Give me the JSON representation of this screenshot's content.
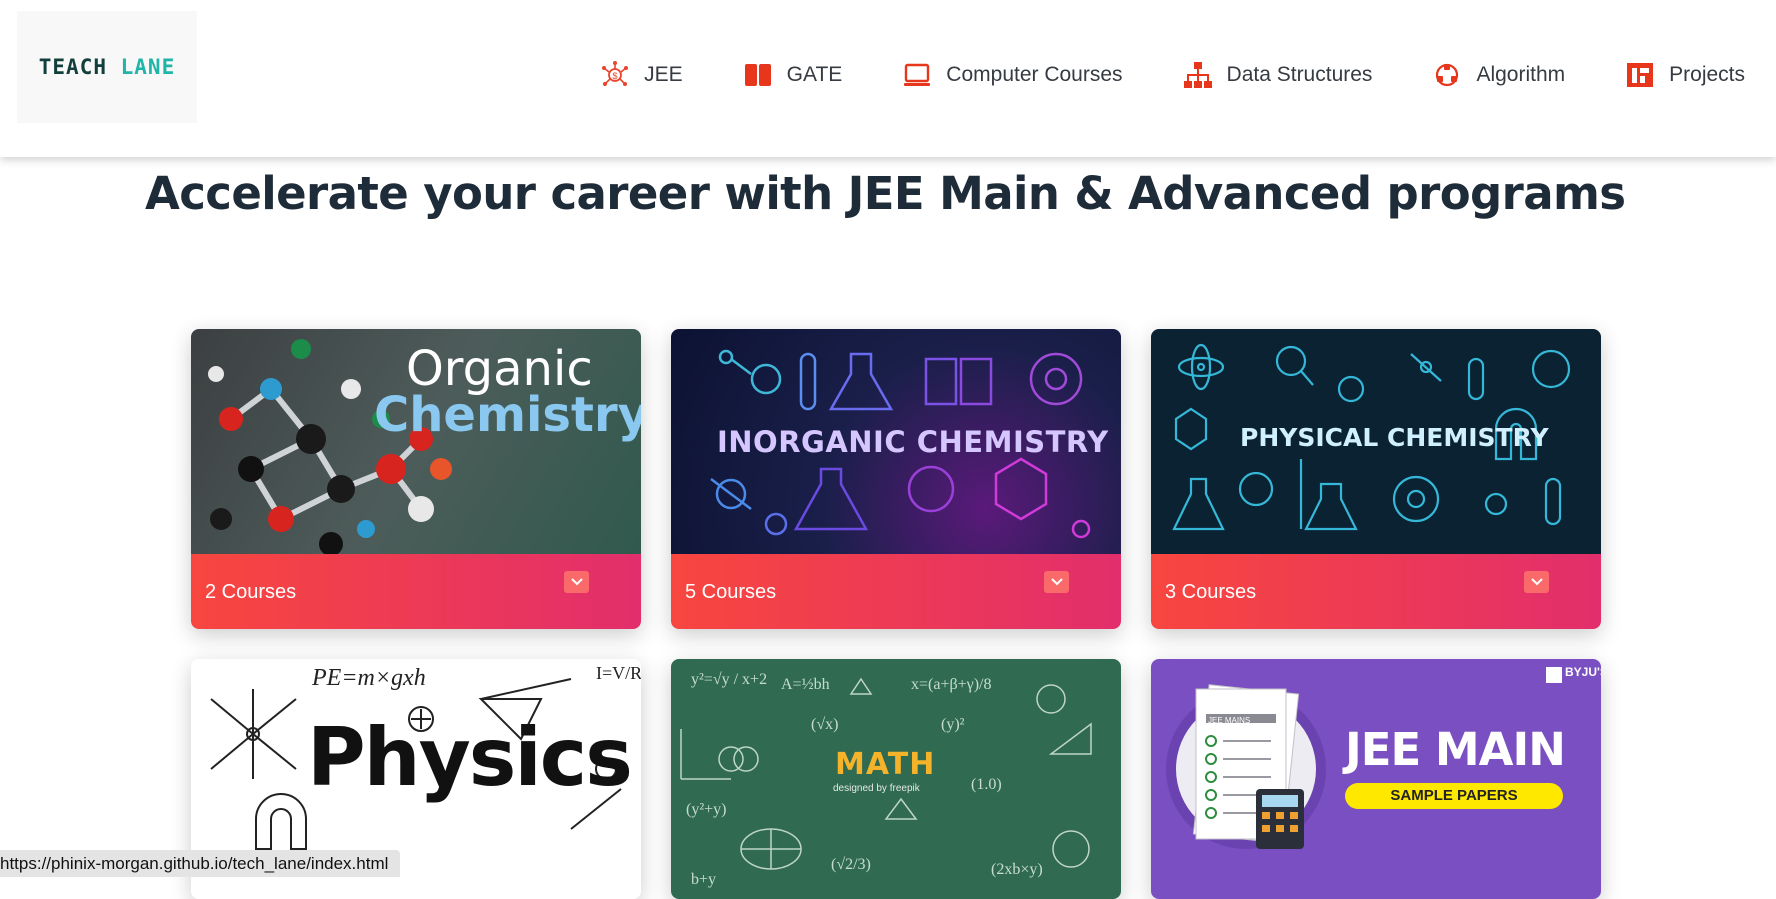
{
  "brand": {
    "logo_part1": "TEACH",
    "logo_part2": "LANE"
  },
  "nav": [
    {
      "label": "JEE",
      "icon": "molecule-dollar-icon"
    },
    {
      "label": "GATE",
      "icon": "book-open-icon"
    },
    {
      "label": "Computer Courses",
      "icon": "laptop-icon"
    },
    {
      "label": "Data Structures",
      "icon": "hierarchy-icon"
    },
    {
      "label": "Algorithm",
      "icon": "cubes-icon"
    },
    {
      "label": "Projects",
      "icon": "layout-icon"
    }
  ],
  "headline": "Accelerate your career with JEE Main & Advanced programs",
  "cards": [
    {
      "image_title_line1": "Organic",
      "image_title_line2": "Chemistry",
      "count": "2 Courses"
    },
    {
      "image_title": "INORGANIC CHEMISTRY",
      "count": "5 Courses"
    },
    {
      "image_title": "PHYSICAL CHEMISTRY",
      "count": "3 Courses"
    },
    {
      "image_title": "Physics",
      "formula": "PE=m×gxh",
      "formula2": "I=V/R"
    },
    {
      "image_title": "MATH",
      "credit": "designed by freepik"
    },
    {
      "image_title_line1": "JEE MAIN",
      "image_title_line2": "SAMPLE PAPERS",
      "badge": "BYJU'S",
      "paper_label": "JEE MAINS"
    }
  ],
  "status_bar": {
    "url": "https://phinix-morgan.github.io/tech_lane/index.html"
  },
  "colors": {
    "accent": "#f03c3c",
    "footer_start": "#f8463f",
    "footer_end": "#e22e6c"
  }
}
